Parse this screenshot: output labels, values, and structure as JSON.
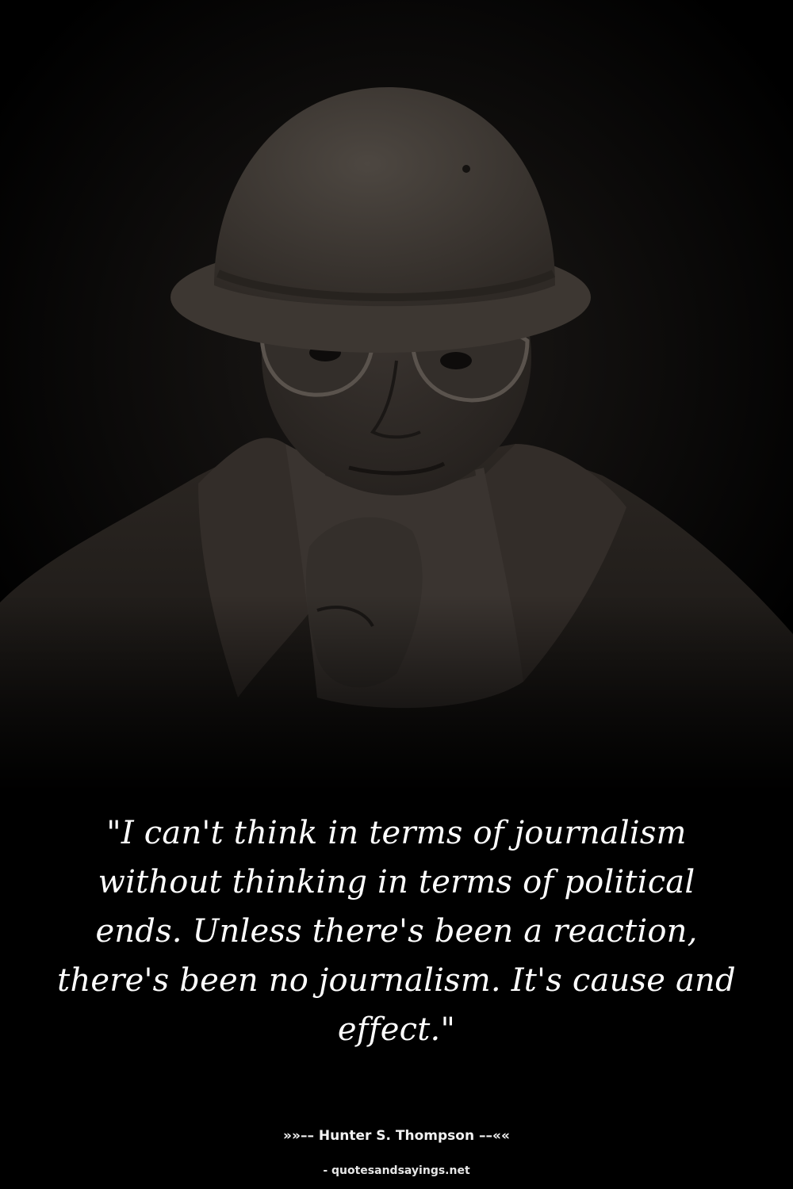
{
  "quote": {
    "text": "\"I can't think in terms of journalism without thinking in terms of political ends. Unless there's been a reaction, there's been no journalism. It's cause and effect.\""
  },
  "attribution": {
    "prefix": "»»–– ",
    "author": "Hunter S. Thompson",
    "suffix": " ––««"
  },
  "source": {
    "text": "- quotesandsayings.net"
  },
  "colors": {
    "background": "#000000",
    "photo_tone": "#2a2522",
    "text": "#ffffff"
  }
}
